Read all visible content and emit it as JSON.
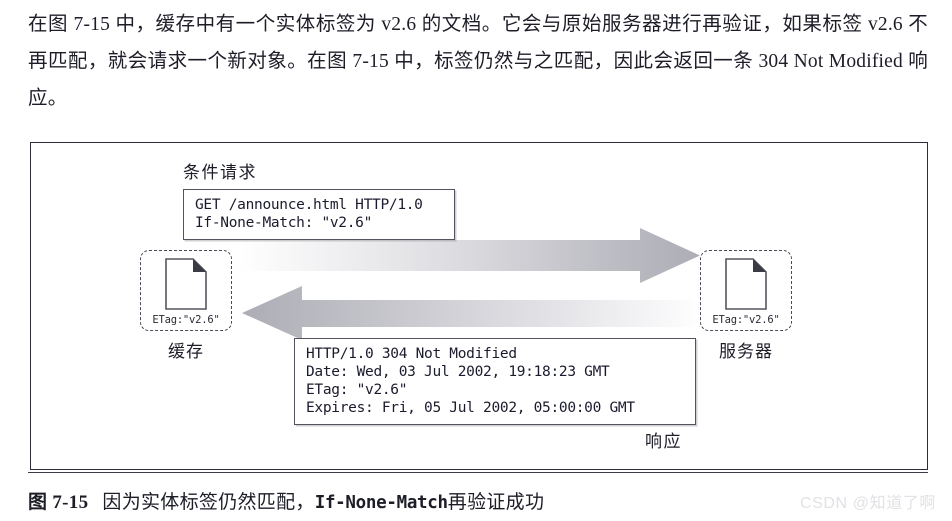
{
  "paragraph": {
    "text": "在图 7-15 中，缓存中有一个实体标签为 v2.6 的文档。它会与原始服务器进行再验证，如果标签 v2.6 不再匹配，就会请求一个新对象。在图 7-15 中，标签仍然与之匹配，因此会返回一条 304 Not Modified 响应。"
  },
  "figure": {
    "labels": {
      "conditional_request": "条件请求",
      "response": "响应"
    },
    "nodes": {
      "cache": {
        "label": "缓存",
        "etag": "ETag:\"v2.6\"",
        "icon": "document-icon"
      },
      "server": {
        "label": "服务器",
        "etag": "ETag:\"v2.6\"",
        "icon": "document-icon"
      }
    },
    "request_message": {
      "lines": [
        "GET /announce.html HTTP/1.0",
        "If-None-Match: \"v2.6\""
      ]
    },
    "response_message": {
      "lines": [
        "HTTP/1.0 304 Not Modified",
        "Date: Wed, 03 Jul 2002, 19:18:23 GMT",
        "ETag: \"v2.6\"",
        "Expires: Fri, 05 Jul 2002, 05:00:00 GMT"
      ]
    },
    "arrows": {
      "request_direction": "right",
      "response_direction": "left",
      "color_dark": "#b0b0b6",
      "color_light": "#ffffff"
    }
  },
  "caption": {
    "figure_number": "图 7-15",
    "text_before": "因为实体标签仍然匹配，",
    "code": "If-None-Match",
    "text_after": "再验证成功"
  },
  "watermark": {
    "text": "CSDN @知道了啊",
    "color": "#e2e2e6"
  }
}
